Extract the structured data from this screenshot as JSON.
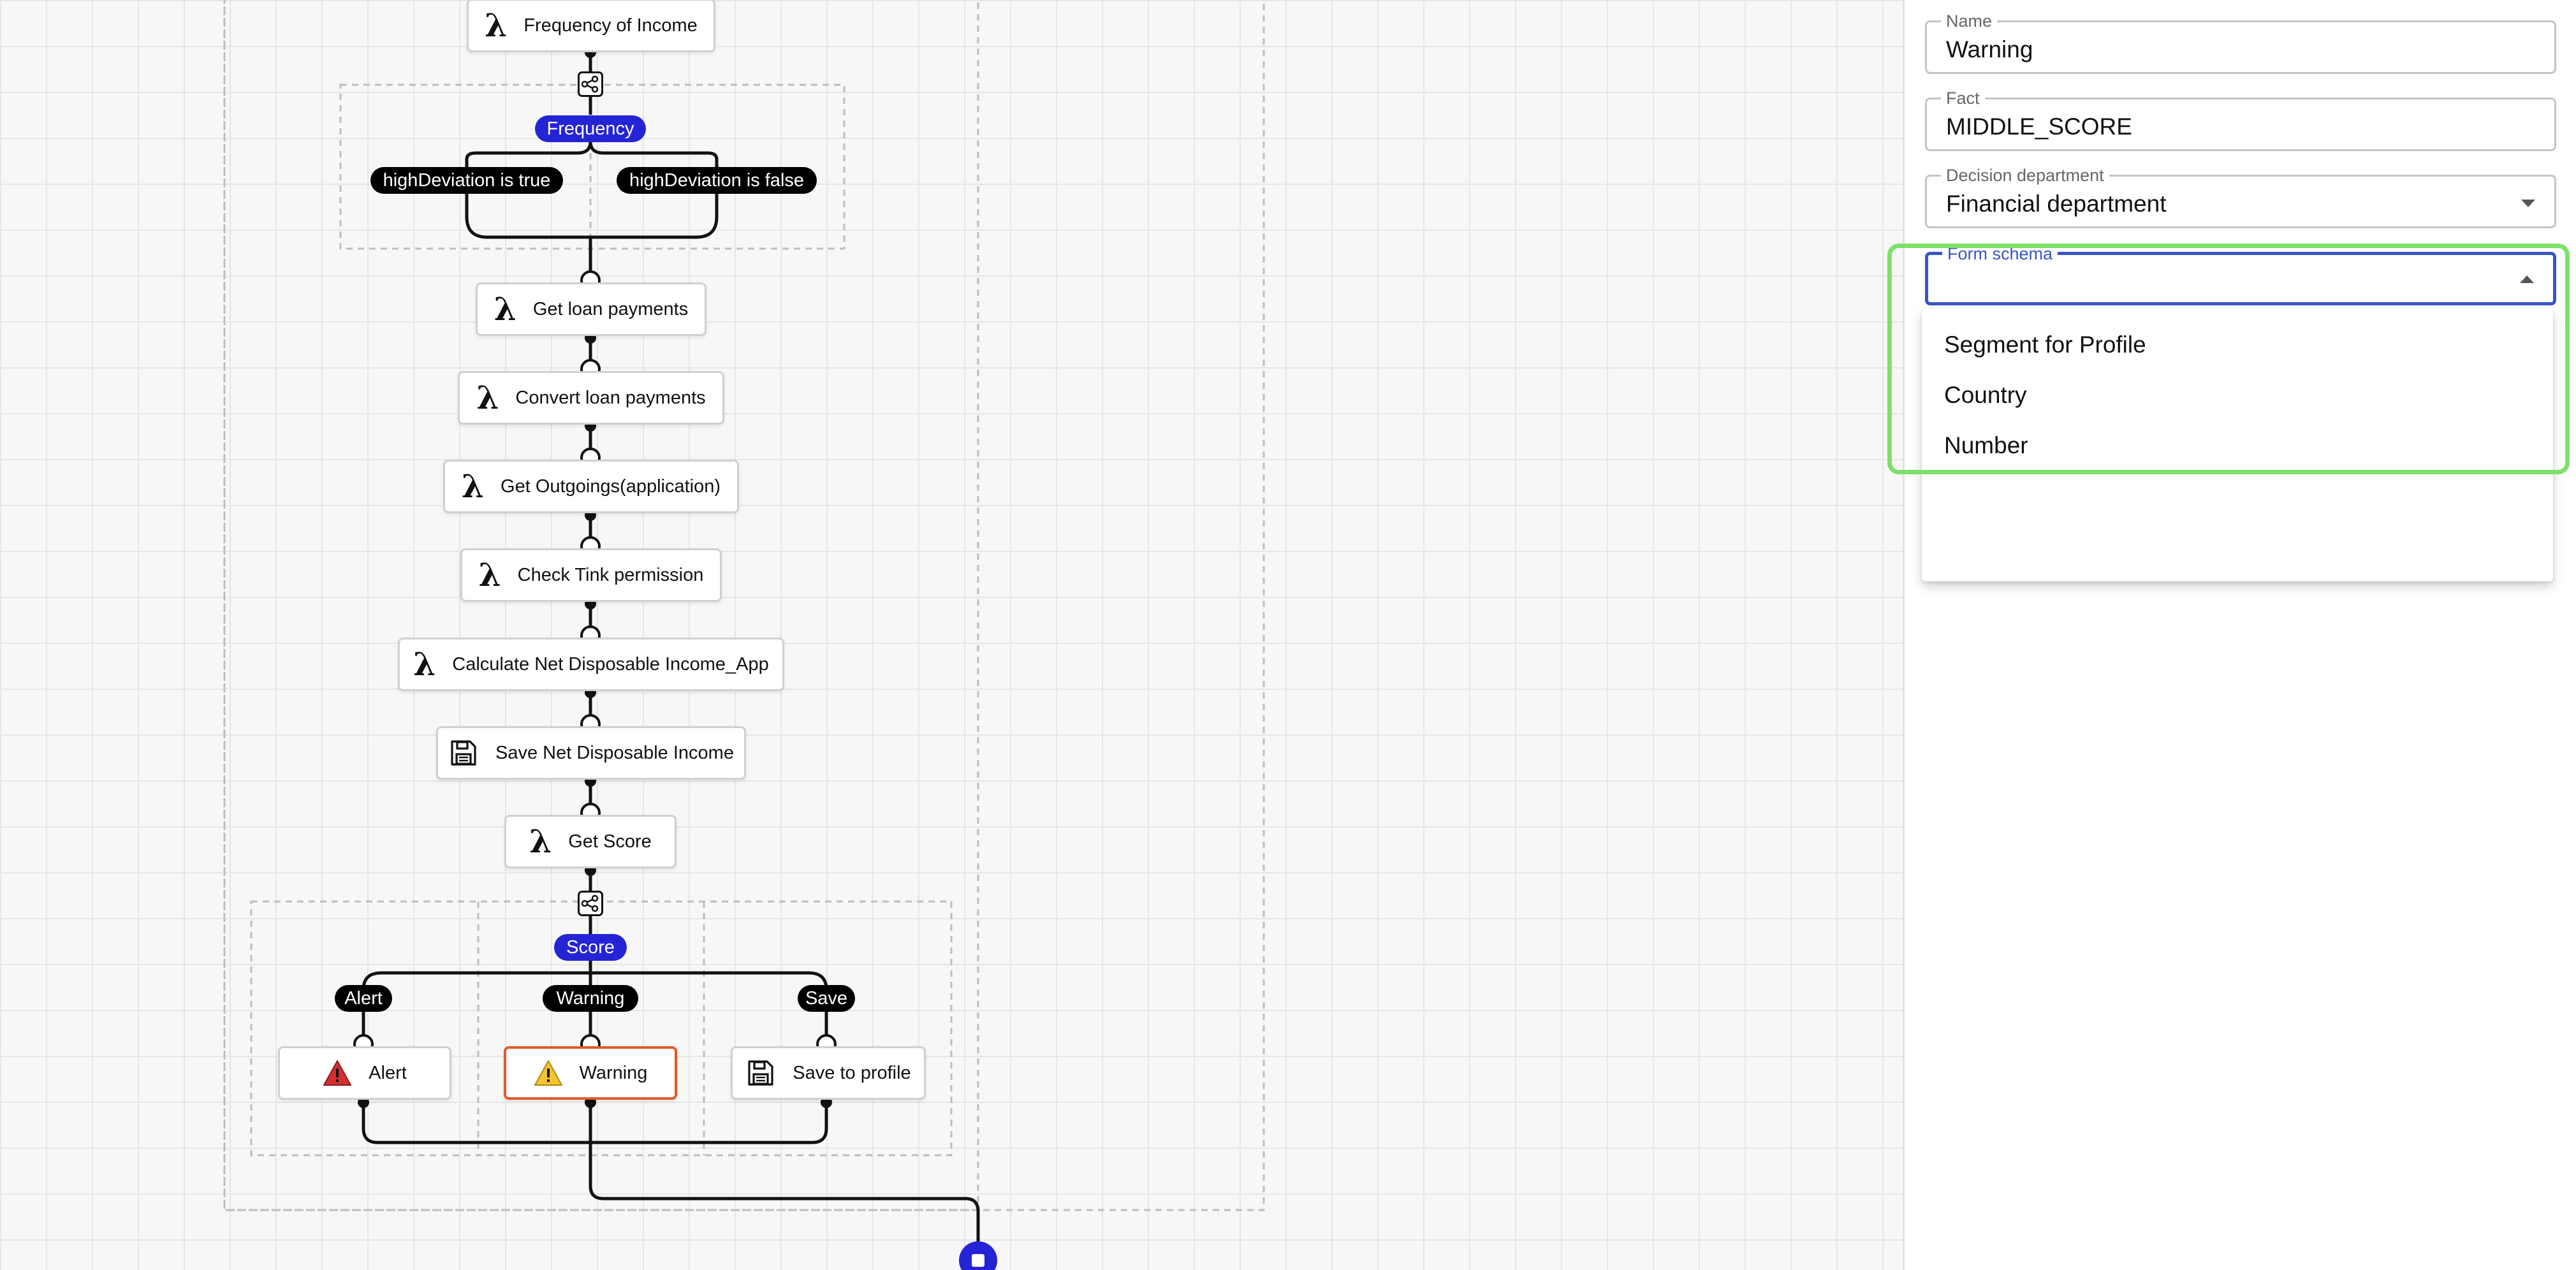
{
  "flow": {
    "nodes": {
      "frequency_of_income": {
        "label": "Frequency of Income",
        "icon": "lambda-icon"
      },
      "get_loan_payments": {
        "label": "Get loan payments",
        "icon": "lambda-icon"
      },
      "convert_loan_payments": {
        "label": "Convert loan payments",
        "icon": "lambda-icon"
      },
      "get_outgoings": {
        "label": "Get Outgoings(application)",
        "icon": "lambda-icon"
      },
      "check_tink": {
        "label": "Check Tink permission",
        "icon": "lambda-icon"
      },
      "calc_ndi": {
        "label": "Calculate Net Disposable Income_App",
        "icon": "lambda-icon"
      },
      "save_ndi": {
        "label": "Save Net Disposable Income",
        "icon": "floppy-disk-icon"
      },
      "get_score": {
        "label": "Get Score",
        "icon": "lambda-icon"
      },
      "alert": {
        "label": "Alert",
        "icon": "warning-triangle-icon",
        "icon_color": "#d32f2f"
      },
      "warning": {
        "label": "Warning",
        "icon": "warning-triangle-icon",
        "icon_color": "#f4c430",
        "selected": true
      },
      "save_to_profile": {
        "label": "Save to profile",
        "icon": "floppy-disk-icon"
      }
    },
    "switches": {
      "frequency": {
        "label": "Frequency",
        "branches": [
          "highDeviation is true",
          "highDeviation is false"
        ]
      },
      "score": {
        "label": "Score",
        "branches": [
          "Alert",
          "Warning",
          "Save"
        ]
      }
    },
    "colors": {
      "switch_pill": "#2424d6",
      "selected_border": "#e05a2b",
      "end_node": "#2424d6"
    }
  },
  "panel": {
    "fields": {
      "name": {
        "label": "Name",
        "value": "Warning"
      },
      "fact": {
        "label": "Fact",
        "value": "MIDDLE_SCORE"
      },
      "department": {
        "label": "Decision department",
        "value": "Financial department"
      },
      "form_schema": {
        "label": "Form schema",
        "value": ""
      }
    },
    "form_schema_options": [
      "Segment for Profile",
      "Country",
      "Number"
    ]
  }
}
